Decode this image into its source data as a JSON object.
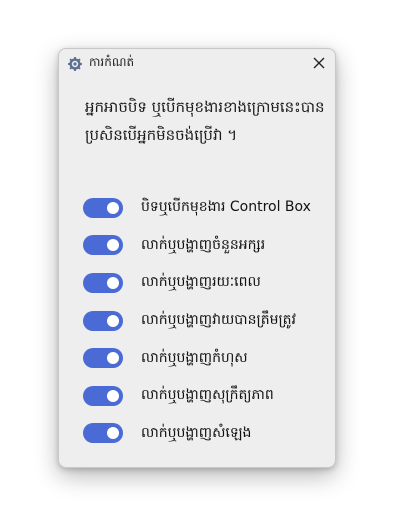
{
  "window": {
    "title": "ការកំណត់",
    "app_icon": "gear-icon",
    "close_icon": "close-icon"
  },
  "description": "អ្នកអាចបិទ ឬបើកមុខងារខាងក្រោមនេះបាន ប្រសិនបើអ្នកមិនចង់ប្រើវា ។",
  "toggles": [
    {
      "label": "បិទឬបើកមុខងារ Control Box",
      "on": true
    },
    {
      "label": "លាក់ឬបង្ហាញចំនួនអក្សរ",
      "on": true
    },
    {
      "label": "លាក់ឬបង្ហាញរយៈពេល",
      "on": true
    },
    {
      "label": "លាក់ឬបង្ហាញវាយបានត្រឹមត្រូវ",
      "on": true
    },
    {
      "label": "លាក់ឬបង្ហាញកំហុស",
      "on": true
    },
    {
      "label": "លាក់ឬបង្ហាញសុក្រឹត្យភាព",
      "on": true
    },
    {
      "label": "លាក់ឬបង្ហាញសំឡេង",
      "on": true
    }
  ],
  "colors": {
    "toggle_on": "#4a6ad6",
    "dialog_bg": "#eeeeee"
  }
}
